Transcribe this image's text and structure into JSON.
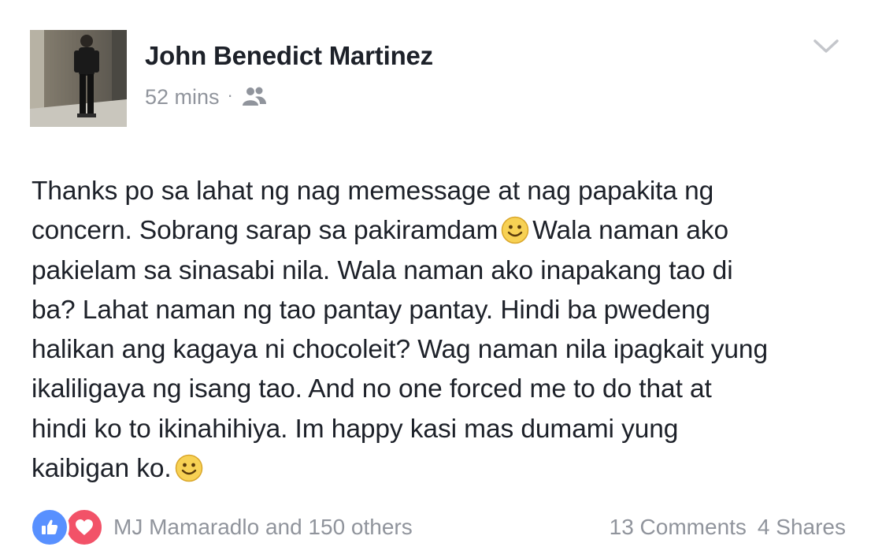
{
  "post": {
    "author": {
      "name": "John Benedict Martinez"
    },
    "timestamp": "52 mins",
    "separator": "·",
    "audience_icon": "friends-icon",
    "menu_icon": "chevron-down-icon",
    "text_lines": [
      "Thanks po sa lahat ng nag memessage at nag papakita ng",
      "concern. Sobrang sarap sa pakiramdam",
      "Wala naman ako",
      "pakielam sa sinasabi nila. Wala naman ako inapakang tao di",
      "ba? Lahat naman ng tao pantay pantay. Hindi ba pwedeng",
      "halikan ang kagaya ni chocoleit? Wag naman nila ipagkait yung",
      "ikaliligaya ng isang tao. And no one forced me to do that at",
      "hindi ko to ikinahihiya. Im happy kasi mas dumami yung",
      "kaibigan ko."
    ],
    "emoji": "smile-emoji"
  },
  "footer": {
    "reaction_icons": [
      "like-icon",
      "love-icon"
    ],
    "reactors": "MJ Mamaradlo and 150 others",
    "comments": "13 Comments",
    "shares": "4 Shares"
  },
  "colors": {
    "text": "#1d2129",
    "muted": "#90949c",
    "like": "#5890ff",
    "love": "#f25268",
    "emoji": "#f7d154"
  }
}
